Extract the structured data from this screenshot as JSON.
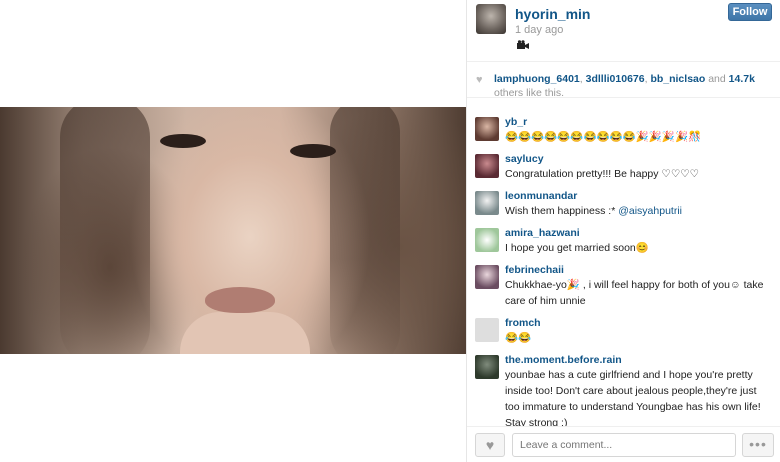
{
  "post": {
    "username": "hyorin_min",
    "time": "1 day ago",
    "media_icon": "video-camera-icon",
    "follow_label": "Follow"
  },
  "likes": {
    "users": [
      "lamphuong_6401",
      "3dllli010676",
      "bb_niclsao"
    ],
    "sep1": ", ",
    "sep2": ", ",
    "suffix_and": " and ",
    "count": "14.7k",
    "suffix_tail": " others like this."
  },
  "comments": [
    {
      "user": "yb_r",
      "text": "😂😂😂😂😂😂😂😂😂😂🎉🎉🎉🎉🎊",
      "mention": ""
    },
    {
      "user": "saylucy",
      "text": "Congratulation pretty!!! Be happy ♡♡♡♡",
      "mention": ""
    },
    {
      "user": "leonmunandar",
      "text": "Wish them happiness :* ",
      "mention": "@aisyahputrii"
    },
    {
      "user": "amira_hazwani",
      "text": "I hope you get married soon😊",
      "mention": ""
    },
    {
      "user": "febrinechaii",
      "text": "Chukkhae-yo🎉 , i will feel happy for both of you☺ take care of him unnie",
      "mention": ""
    },
    {
      "user": "fromch",
      "text": "😂😂",
      "mention": ""
    },
    {
      "user": "the.moment.before.rain",
      "text": "younbae has a cute girlfriend and I hope you're pretty inside too! Don't care about jealous people,they're just too immature to understand Youngbae has his own life! Stay strong :)",
      "mention": ""
    }
  ],
  "footer": {
    "comment_placeholder": "Leave a comment...",
    "more_label": "•••"
  },
  "colors": {
    "link_blue": "#125688",
    "follow_blue": "#3f76a8"
  }
}
